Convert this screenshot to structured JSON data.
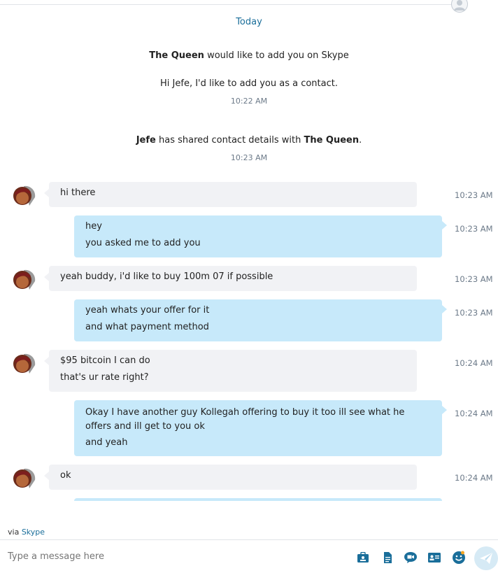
{
  "header": {
    "day_label": "Today"
  },
  "system": [
    {
      "parts": [
        {
          "bold": "The Queen"
        },
        {
          "text": " would like to add you on Skype"
        }
      ]
    },
    {
      "text": "Hi Jefe, I'd like to add you as a contact.",
      "time": "10:22 AM"
    },
    {
      "parts": [
        {
          "bold": "Jefe"
        },
        {
          "text": " has shared contact details with "
        },
        {
          "bold": "The Queen"
        },
        {
          "text": "."
        }
      ],
      "time": "10:23 AM"
    }
  ],
  "messages": [
    {
      "direction": "incoming",
      "lines": [
        "hi there"
      ],
      "time": "10:23 AM"
    },
    {
      "direction": "outgoing",
      "lines": [
        "hey",
        "you asked me to add you"
      ],
      "time": "10:23 AM"
    },
    {
      "direction": "incoming",
      "lines": [
        "yeah buddy, i'd like to buy 100m 07 if possible"
      ],
      "time": "10:23 AM"
    },
    {
      "direction": "outgoing",
      "lines": [
        "yeah whats your offer for it",
        "and what payment method"
      ],
      "time": "10:23 AM"
    },
    {
      "direction": "incoming",
      "lines": [
        "$95 bitcoin I can do",
        "that's ur rate right?"
      ],
      "time": "10:24 AM"
    },
    {
      "direction": "outgoing",
      "lines": [
        "Okay I have another guy Kollegah offering to buy it too ill see what he offers and ill get to you ok",
        "and yeah"
      ],
      "time": "10:24 AM"
    },
    {
      "direction": "incoming",
      "lines": [
        "ok"
      ],
      "time": "10:24 AM"
    }
  ],
  "footer": {
    "via_prefix": "via",
    "via_link": "Skype",
    "compose_placeholder": "Type a message here"
  },
  "toolbar_icons": [
    "send-contacts-icon",
    "file-icon",
    "video-message-icon",
    "contact-card-icon",
    "emoticon-icon",
    "send-icon"
  ],
  "colors": {
    "accent": "#1a6e9a",
    "outgoing_bubble": "#c7e9fa",
    "incoming_bubble": "#f1f2f5"
  }
}
